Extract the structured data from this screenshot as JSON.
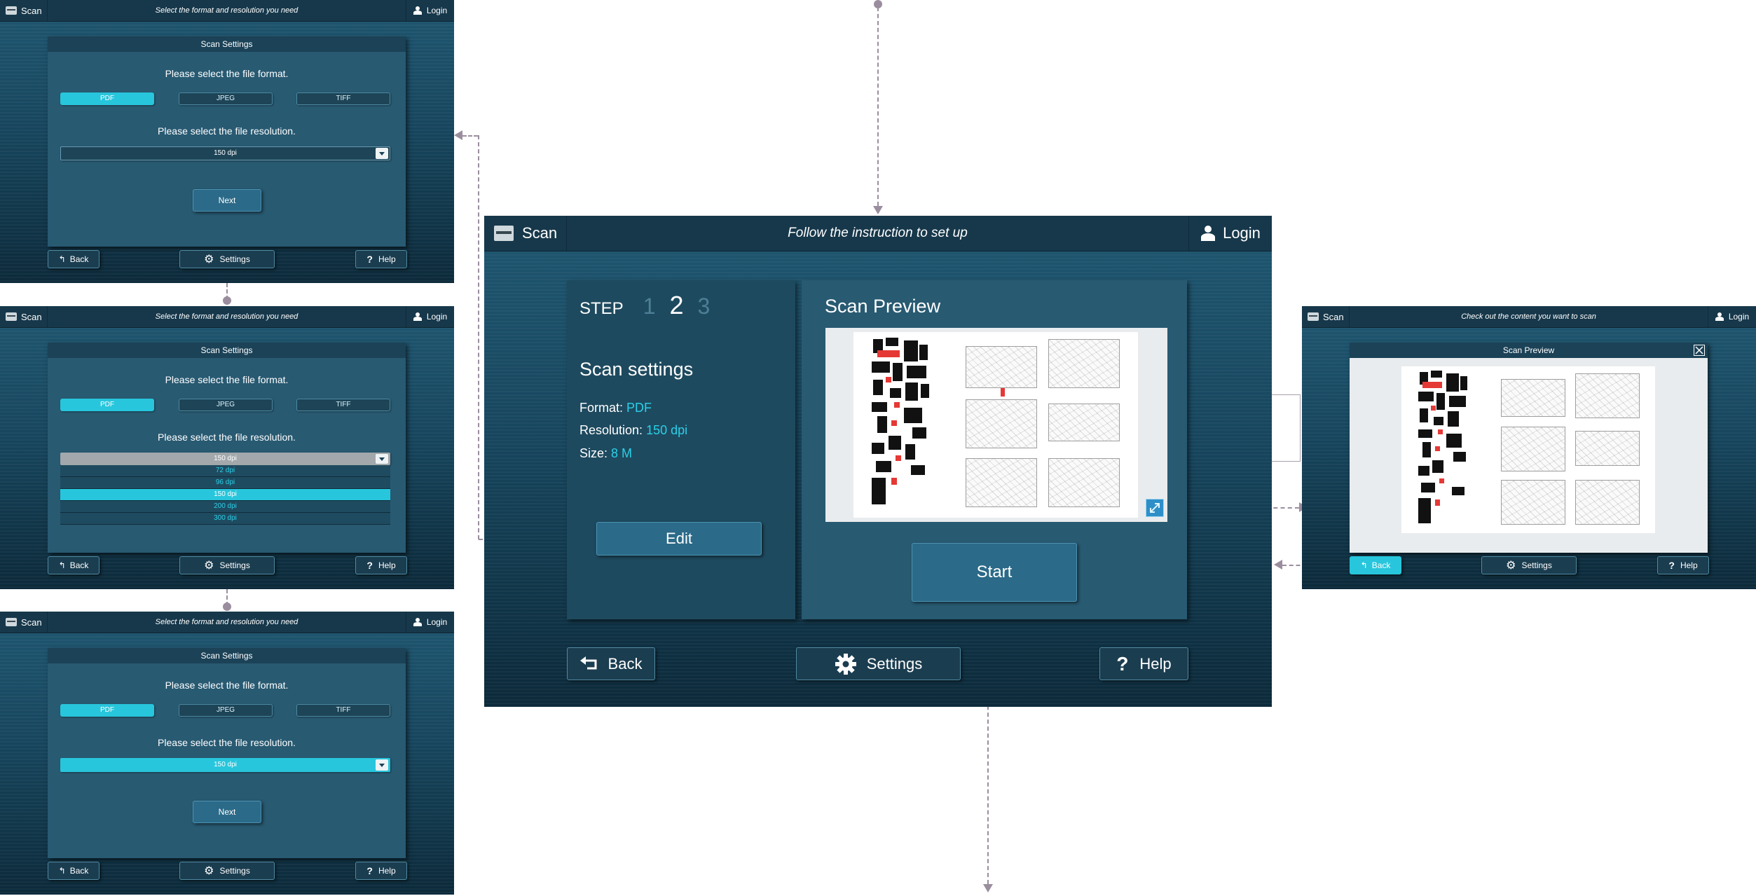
{
  "colors": {
    "accent": "#27c6dc",
    "highlight_text": "#2bd0e8",
    "panel": "#285a72",
    "header": "#17384b",
    "connector": "#9a8e9e"
  },
  "icons": {
    "scanner": "scanner-icon",
    "user": "person-icon",
    "back": "back-arrow-icon",
    "settings": "gear-icon",
    "help": "question-icon",
    "expand": "expand-icon",
    "close": "close-icon",
    "dropdown": "chevron-down-icon"
  },
  "main": {
    "app_name": "Scan",
    "instruction": "Follow the instruction to set up",
    "login": "Login",
    "step_label": "STEP",
    "steps": [
      "1",
      "2",
      "3"
    ],
    "current_step": 2,
    "settings_title": "Scan settings",
    "format_label": "Format:",
    "format_value": "PDF",
    "resolution_label": "Resolution:",
    "resolution_value": "150 dpi",
    "size_label": "Size:",
    "size_value": "8 M",
    "edit": "Edit",
    "preview_title": "Scan Preview",
    "start": "Start",
    "back": "Back",
    "settings": "Settings",
    "help": "Help"
  },
  "format_screens": {
    "app_name": "Scan",
    "instruction": "Select the format and resolution you need",
    "login": "Login",
    "panel_title": "Scan Settings",
    "format_prompt": "Please select the file format.",
    "formats": [
      "PDF",
      "JPEG",
      "TIFF"
    ],
    "resolution_prompt": "Please select the file resolution.",
    "resolution_value": "150 dpi",
    "resolution_options": [
      "72 dpi",
      "96 dpi",
      "150 dpi",
      "200 dpi",
      "300 dpi"
    ],
    "next": "Next",
    "back": "Back",
    "settings": "Settings",
    "help": "Help"
  },
  "preview_screen": {
    "app_name": "Scan",
    "instruction": "Check out the content you want to scan",
    "login": "Login",
    "dialog_title": "Scan Preview",
    "back": "Back",
    "settings": "Settings",
    "help": "Help"
  }
}
